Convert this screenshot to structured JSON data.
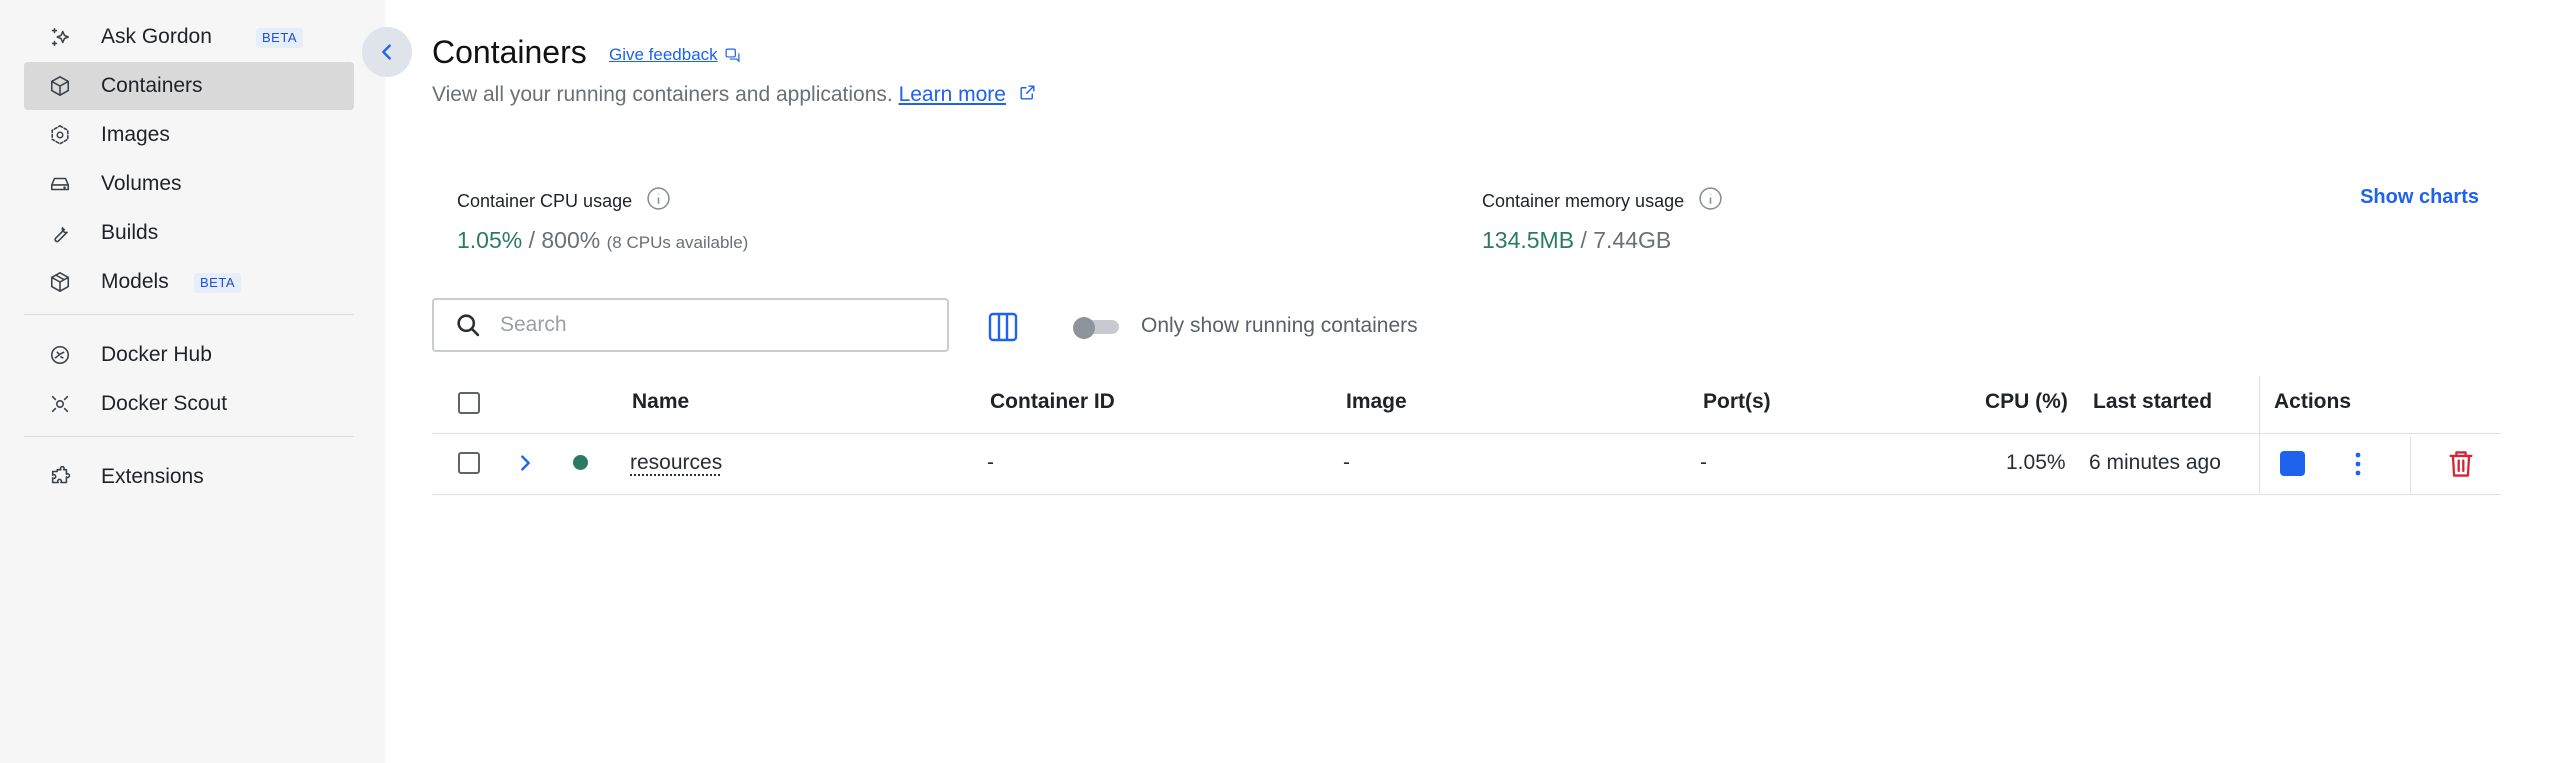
{
  "sidebar": {
    "items": [
      {
        "label": "Ask Gordon",
        "icon": "sparkle-icon",
        "badge": "BETA"
      },
      {
        "label": "Containers",
        "icon": "container-icon",
        "active": true
      },
      {
        "label": "Images",
        "icon": "images-icon"
      },
      {
        "label": "Volumes",
        "icon": "volume-icon"
      },
      {
        "label": "Builds",
        "icon": "wrench-icon"
      },
      {
        "label": "Models",
        "icon": "cube-icon",
        "badge": "BETA"
      },
      {
        "label": "Docker Hub",
        "icon": "docker-hub-icon"
      },
      {
        "label": "Docker Scout",
        "icon": "scout-icon"
      },
      {
        "label": "Extensions",
        "icon": "puzzle-icon"
      }
    ]
  },
  "header": {
    "title": "Containers",
    "feedback": "Give feedback",
    "subtitle": "View all your running containers and applications.",
    "learn_more": "Learn more"
  },
  "stats": {
    "cpu_label": "Container CPU usage",
    "cpu_used": "1.05%",
    "cpu_sep": " / 800%",
    "cpu_note": "(8 CPUs available)",
    "mem_label": "Container memory usage",
    "mem_used": "134.5MB",
    "mem_sep": " / 7.44GB",
    "show_charts": "Show charts"
  },
  "toolbar": {
    "search_placeholder": "Search",
    "toggle_label": "Only show running containers",
    "toggle_on": false
  },
  "table": {
    "columns": [
      "Name",
      "Container ID",
      "Image",
      "Port(s)",
      "CPU (%)",
      "Last started",
      "Actions"
    ],
    "rows": [
      {
        "name": "resources",
        "container_id": "-",
        "image": "-",
        "ports": "-",
        "cpu": "1.05%",
        "last_started": "6 minutes ago",
        "status": "running"
      }
    ]
  },
  "colors": {
    "accent": "#1d63ed",
    "running": "#2b7a66",
    "danger": "#d52536"
  }
}
